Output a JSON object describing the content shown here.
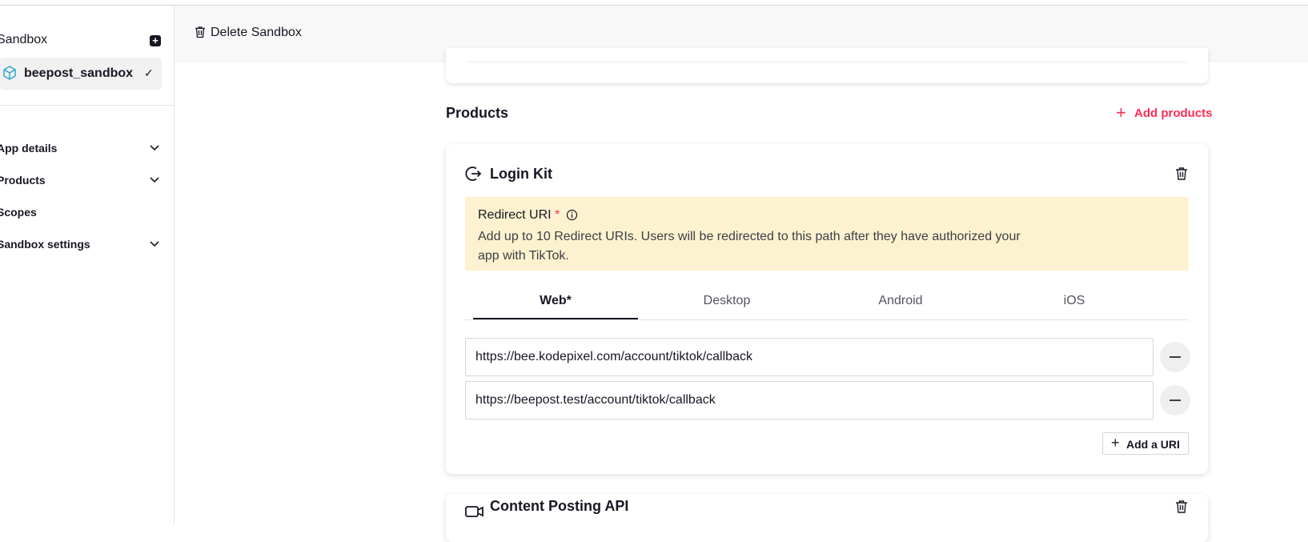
{
  "sidebar": {
    "title": "Sandbox",
    "sandbox_item": {
      "label": "beepost_sandbox",
      "check": "✓"
    },
    "nav": [
      {
        "label": "App details"
      },
      {
        "label": "Products"
      },
      {
        "label": "Scopes"
      },
      {
        "label": "Sandbox settings"
      }
    ]
  },
  "header": {
    "delete_label": "Delete Sandbox"
  },
  "products": {
    "title": "Products",
    "add_label": "Add products",
    "accent_color": "#fe2c55"
  },
  "login_kit": {
    "title": "Login Kit",
    "notice": {
      "title": "Redirect URI",
      "required_mark": "*",
      "text": "Add up to 10 Redirect URIs. Users will be redirected to this path after they have authorized your app with TikTok."
    },
    "tabs": [
      {
        "label": "Web*",
        "active": true
      },
      {
        "label": "Desktop",
        "active": false
      },
      {
        "label": "Android",
        "active": false
      },
      {
        "label": "iOS",
        "active": false
      }
    ],
    "uris": [
      "https://bee.kodepixel.com/account/tiktok/callback",
      "https://beepost.test/account/tiktok/callback"
    ],
    "add_uri_label": "Add a URI"
  },
  "content_posting": {
    "title": "Content Posting API"
  }
}
